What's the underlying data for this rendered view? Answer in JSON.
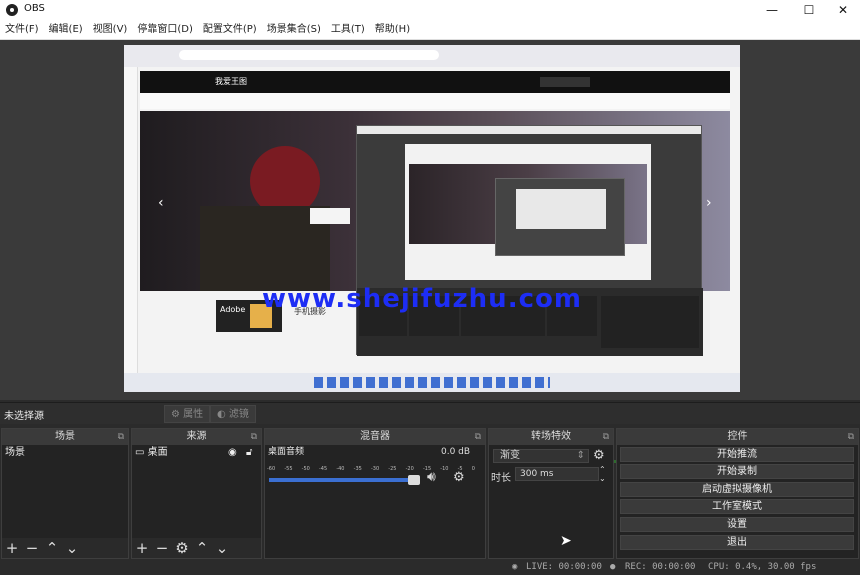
{
  "window": {
    "title": "OBS",
    "minimize": "—",
    "maximize": "☐",
    "close": "✕"
  },
  "menu": [
    "文件(F)",
    "编辑(E)",
    "视图(V)",
    "停靠窗口(D)",
    "配置文件(P)",
    "场景集合(S)",
    "工具(T)",
    "帮助(H)"
  ],
  "preview": {
    "watermark": "www.shejifuzhu.com",
    "site_logo": "我爱王图",
    "card_brand": "Adobe",
    "card_title": "手机摄影"
  },
  "scene_bar": {
    "label": "未选择源",
    "properties": "属性",
    "filters": "滤镜"
  },
  "scenes": {
    "title": "场景",
    "items": [
      "场景"
    ]
  },
  "sources": {
    "title": "来源",
    "items": [
      {
        "name": "桌面",
        "icon": "monitor-icon"
      }
    ]
  },
  "mixer": {
    "title": "混音器",
    "channel": "桌面音频",
    "db": "0.0 dB",
    "scale": [
      "-60",
      "-55",
      "-50",
      "-45",
      "-40",
      "-35",
      "-30",
      "-25",
      "-20",
      "-15",
      "-10",
      "-5",
      "0"
    ]
  },
  "transitions": {
    "title": "转场特效",
    "selected": "渐变",
    "duration_label": "时长",
    "duration_value": "300 ms"
  },
  "controls": {
    "title": "控件",
    "buttons": [
      "开始推流",
      "开始录制",
      "启动虚拟摄像机",
      "工作室模式",
      "设置",
      "退出"
    ]
  },
  "status": {
    "live": "LIVE: 00:00:00",
    "rec": "REC: 00:00:00",
    "cpu": "CPU: 0.4%, 30.00 fps"
  },
  "colors": {
    "accent": "#1d2df5",
    "panel": "#232323",
    "header": "#3a3a3a"
  }
}
